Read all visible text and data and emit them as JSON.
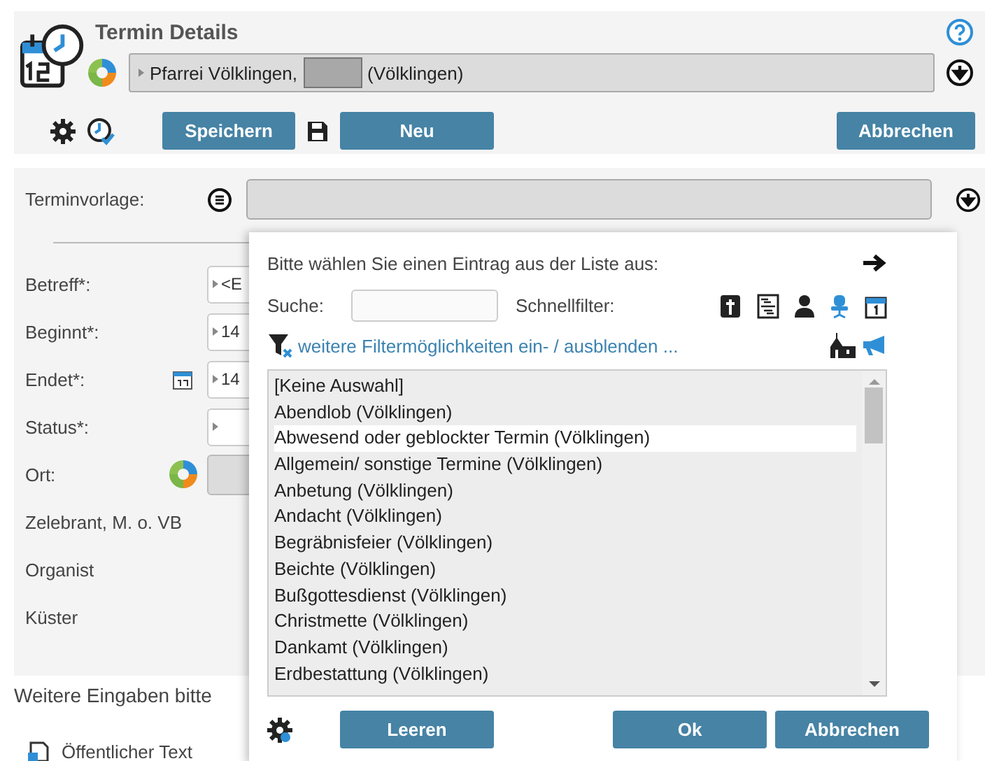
{
  "header": {
    "title": "Termin Details",
    "parish_prefix": "Pfarrei Völklingen,",
    "parish_suffix": "(Völklingen)"
  },
  "toolbar": {
    "save": "Speichern",
    "new": "Neu",
    "cancel": "Abbrechen"
  },
  "form": {
    "template_label": "Terminvorlage:",
    "fields": [
      {
        "label": "Betreff*:",
        "value": "<E",
        "kind": "text"
      },
      {
        "label": "Beginnt*:",
        "value": "14",
        "kind": "text"
      },
      {
        "label": "Endet*:",
        "value": "14",
        "kind": "date"
      },
      {
        "label": "Status*:",
        "kind": "select"
      },
      {
        "label": "Ort:",
        "kind": "place"
      },
      {
        "label": "Zelebrant, M. o. VB",
        "kind": "plain"
      },
      {
        "label": "Organist",
        "kind": "plain"
      },
      {
        "label": "Küster",
        "kind": "plain"
      }
    ]
  },
  "note": "Weitere Eingaben bitte",
  "public_text": "Öffentlicher Text",
  "popup": {
    "prompt": "Bitte wählen Sie einen Eintrag aus der Liste aus:",
    "search_label": "Suche:",
    "quick_filter_label": "Schnellfilter:",
    "filter_link": "weitere Filtermöglichkeiten ein- / ausblenden ...",
    "items": [
      {
        "label": "[Keine Auswahl]",
        "selected": false
      },
      {
        "label": "Abendlob (Völklingen)",
        "selected": false
      },
      {
        "label": "Abwesend oder geblockter Termin (Völklingen)",
        "selected": true
      },
      {
        "label": "Allgemein/ sonstige Termine (Völklingen)",
        "selected": false
      },
      {
        "label": "Anbetung (Völklingen)",
        "selected": false
      },
      {
        "label": "Andacht (Völklingen)",
        "selected": false
      },
      {
        "label": "Begräbnisfeier (Völklingen)",
        "selected": false
      },
      {
        "label": "Beichte (Völklingen)",
        "selected": false
      },
      {
        "label": "Bußgottesdienst (Völklingen)",
        "selected": false
      },
      {
        "label": "Christmette (Völklingen)",
        "selected": false
      },
      {
        "label": "Dankamt (Völklingen)",
        "selected": false
      },
      {
        "label": "Erdbestattung (Völklingen)",
        "selected": false
      }
    ],
    "buttons": [
      "Leeren",
      "Ok",
      "Abbrechen"
    ]
  }
}
